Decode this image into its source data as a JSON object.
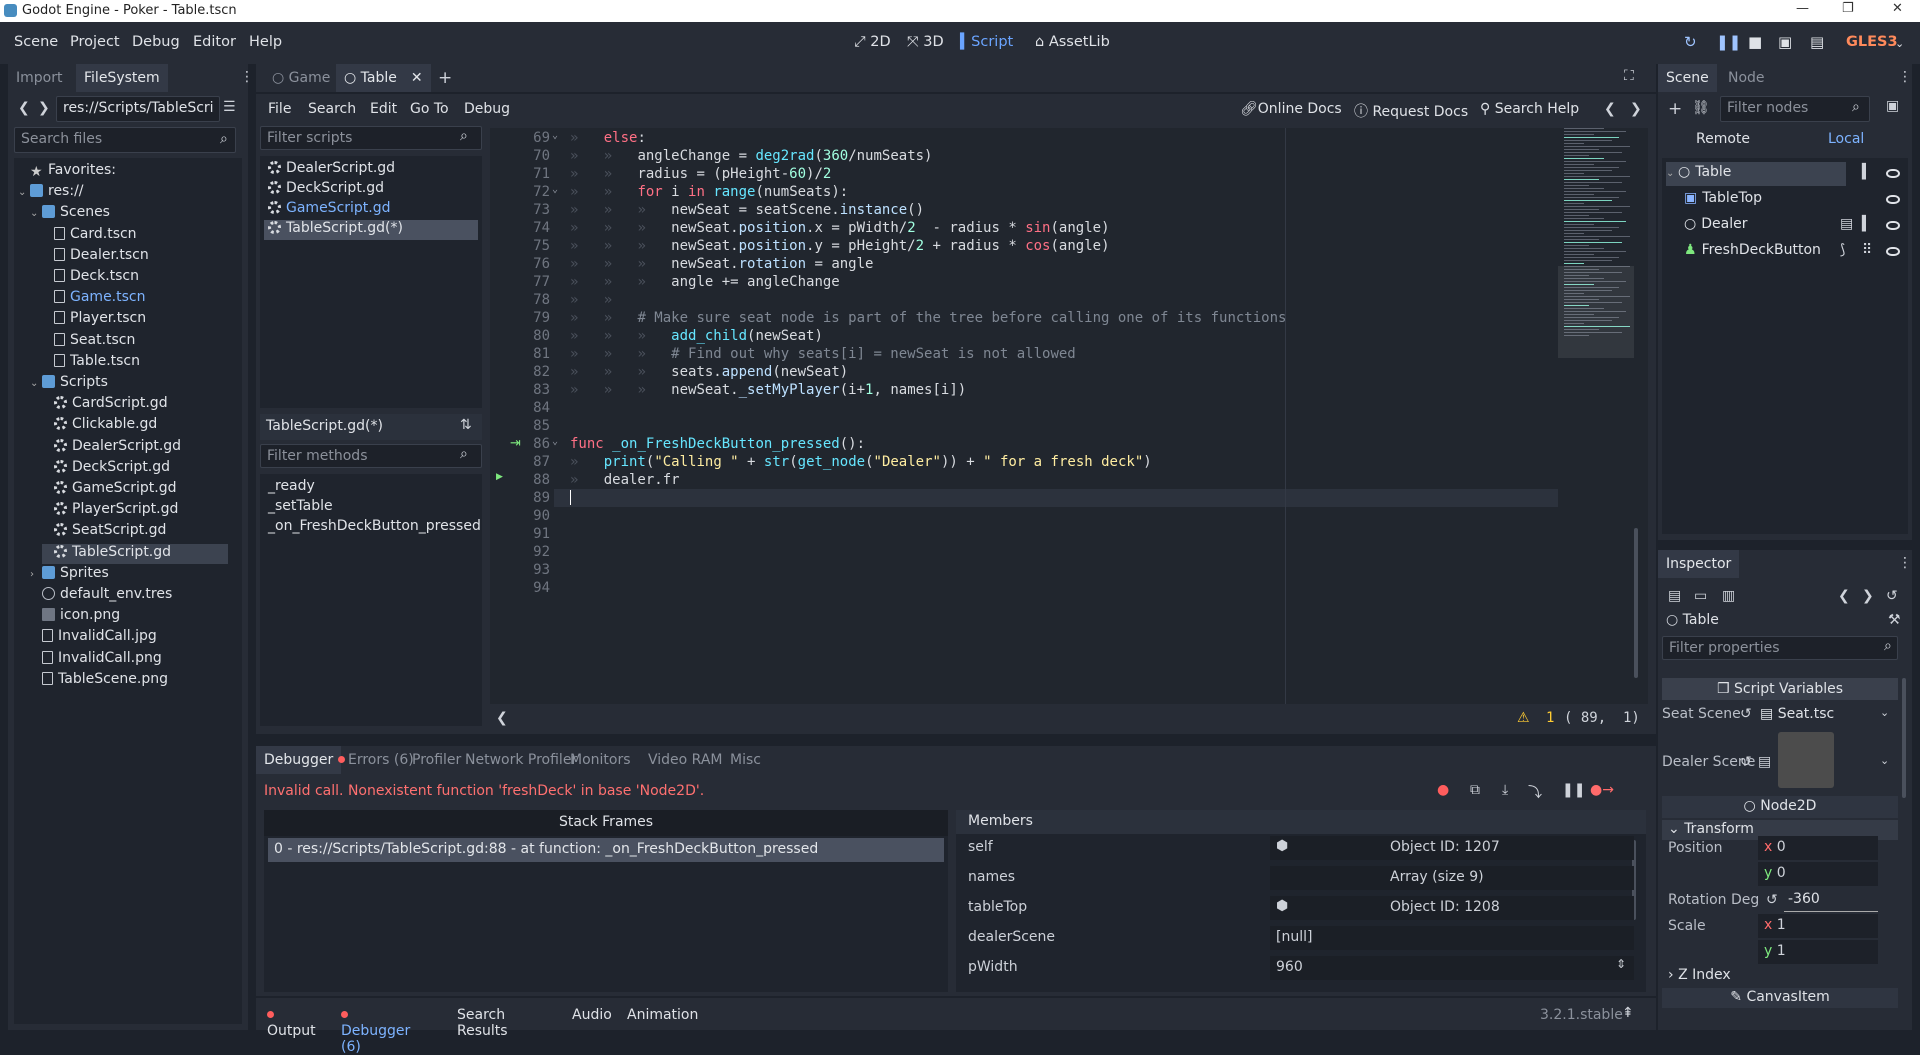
{
  "window": {
    "title": "Godot Engine - Poker - Table.tscn"
  },
  "menu": [
    "Scene",
    "Project",
    "Debug",
    "Editor",
    "Help"
  ],
  "modes": [
    "2D",
    "3D",
    "Script",
    "AssetLib"
  ],
  "renderer": "GLES3",
  "filesystem": {
    "tabs": [
      "Import",
      "FileSystem"
    ],
    "path": "res://Scripts/TableScri",
    "search_placeholder": "Search files",
    "rows": [
      {
        "label": "Favorites:",
        "icon": "star-icon",
        "depth": 0,
        "caret": ""
      },
      {
        "label": "res://",
        "icon": "folder-icon",
        "depth": 0,
        "caret": "v"
      },
      {
        "label": "Scenes",
        "icon": "folder-icon",
        "depth": 1,
        "caret": "v"
      },
      {
        "label": "Card.tscn",
        "icon": "scene-file-icon",
        "depth": 2,
        "caret": ""
      },
      {
        "label": "Dealer.tscn",
        "icon": "scene-file-icon",
        "depth": 2,
        "caret": ""
      },
      {
        "label": "Deck.tscn",
        "icon": "scene-file-icon",
        "depth": 2,
        "caret": ""
      },
      {
        "label": "Game.tscn",
        "icon": "scene-file-icon",
        "depth": 2,
        "caret": "",
        "color": "#7db3ff"
      },
      {
        "label": "Player.tscn",
        "icon": "scene-file-icon",
        "depth": 2,
        "caret": ""
      },
      {
        "label": "Seat.tscn",
        "icon": "scene-file-icon",
        "depth": 2,
        "caret": ""
      },
      {
        "label": "Table.tscn",
        "icon": "scene-file-icon",
        "depth": 2,
        "caret": ""
      },
      {
        "label": "Scripts",
        "icon": "folder-icon",
        "depth": 1,
        "caret": "v"
      },
      {
        "label": "CardScript.gd",
        "icon": "gear-icon",
        "depth": 2,
        "caret": ""
      },
      {
        "label": "Clickable.gd",
        "icon": "gear-icon",
        "depth": 2,
        "caret": ""
      },
      {
        "label": "DealerScript.gd",
        "icon": "gear-icon",
        "depth": 2,
        "caret": ""
      },
      {
        "label": "DeckScript.gd",
        "icon": "gear-icon",
        "depth": 2,
        "caret": ""
      },
      {
        "label": "GameScript.gd",
        "icon": "gear-icon",
        "depth": 2,
        "caret": ""
      },
      {
        "label": "PlayerScript.gd",
        "icon": "gear-icon",
        "depth": 2,
        "caret": ""
      },
      {
        "label": "SeatScript.gd",
        "icon": "gear-icon",
        "depth": 2,
        "caret": ""
      },
      {
        "label": "TableScript.gd",
        "icon": "gear-icon",
        "depth": 2,
        "caret": "",
        "selected": true
      },
      {
        "label": "Sprites",
        "icon": "folder-icon",
        "depth": 1,
        "caret": ">"
      },
      {
        "label": "default_env.tres",
        "icon": "globe-icon",
        "depth": 1,
        "caret": ""
      },
      {
        "label": "icon.png",
        "icon": "image-icon",
        "depth": 1,
        "caret": ""
      },
      {
        "label": "InvalidCall.jpg",
        "icon": "file-icon",
        "depth": 1,
        "caret": ""
      },
      {
        "label": "InvalidCall.png",
        "icon": "file-icon",
        "depth": 1,
        "caret": ""
      },
      {
        "label": "TableScene.png",
        "icon": "file-icon",
        "depth": 1,
        "caret": ""
      }
    ]
  },
  "editor_tabs": [
    {
      "label": "Game"
    },
    {
      "label": "Table",
      "selected": true
    }
  ],
  "script_menu": [
    "File",
    "Search",
    "Edit",
    "Go To",
    "Debug"
  ],
  "help_links": [
    "Online Docs",
    "Request Docs",
    "Search Help"
  ],
  "scripts": {
    "filter_placeholder": "Filter scripts",
    "items": [
      {
        "label": "DealerScript.gd"
      },
      {
        "label": "DeckScript.gd"
      },
      {
        "label": "GameScript.gd",
        "color": "#7db3ff"
      },
      {
        "label": "TableScript.gd(*)",
        "selected": true
      }
    ],
    "current": "TableScript.gd(*)",
    "methods_placeholder": "Filter methods",
    "methods": [
      "_ready",
      "_setTable",
      "_on_FreshDeckButton_pressed"
    ]
  },
  "code": {
    "lines": [
      {
        "n": "69",
        "fold": true,
        "tokens": [
          [
            "i",
            1
          ],
          [
            "kw",
            "else"
          ],
          [
            "t",
            ":"
          ]
        ]
      },
      {
        "n": "70",
        "tokens": [
          [
            "i",
            2
          ],
          [
            "t",
            "angleChange = "
          ],
          [
            "fn",
            "deg2rad"
          ],
          [
            "t",
            "("
          ],
          [
            "nb",
            "360"
          ],
          [
            "t",
            "/numSeats)"
          ]
        ]
      },
      {
        "n": "71",
        "tokens": [
          [
            "i",
            2
          ],
          [
            "t",
            "radius = (pHeight-"
          ],
          [
            "nb",
            "60"
          ],
          [
            "t",
            ")/"
          ],
          [
            "nb",
            "2"
          ]
        ]
      },
      {
        "n": "72",
        "fold": true,
        "tokens": [
          [
            "i",
            2
          ],
          [
            "kw",
            "for"
          ],
          [
            "t",
            " i "
          ],
          [
            "kw",
            "in"
          ],
          [
            "t",
            " "
          ],
          [
            "fn",
            "range"
          ],
          [
            "t",
            "(numSeats):"
          ]
        ]
      },
      {
        "n": "73",
        "tokens": [
          [
            "i",
            3
          ],
          [
            "t",
            "newSeat = seatScene."
          ],
          [
            "mm",
            "instance"
          ],
          [
            "t",
            "()"
          ]
        ]
      },
      {
        "n": "74",
        "tokens": [
          [
            "i",
            3
          ],
          [
            "t",
            "newSeat."
          ],
          [
            "mm",
            "position"
          ],
          [
            "t",
            ".x = pWidth/"
          ],
          [
            "nb",
            "2"
          ],
          [
            "t",
            "  - radius * "
          ],
          [
            "kw",
            "sin"
          ],
          [
            "t",
            "(angle)"
          ]
        ]
      },
      {
        "n": "75",
        "tokens": [
          [
            "i",
            3
          ],
          [
            "t",
            "newSeat."
          ],
          [
            "mm",
            "position"
          ],
          [
            "t",
            ".y = pHeight/"
          ],
          [
            "nb",
            "2"
          ],
          [
            "t",
            " + radius * "
          ],
          [
            "kw",
            "cos"
          ],
          [
            "t",
            "(angle)"
          ]
        ]
      },
      {
        "n": "76",
        "tokens": [
          [
            "i",
            3
          ],
          [
            "t",
            "newSeat."
          ],
          [
            "mm",
            "rotation"
          ],
          [
            "t",
            " = angle"
          ]
        ]
      },
      {
        "n": "77",
        "tokens": [
          [
            "i",
            3
          ],
          [
            "t",
            "angle += angleChange"
          ]
        ]
      },
      {
        "n": "78",
        "tokens": [
          [
            "i",
            2
          ]
        ]
      },
      {
        "n": "79",
        "tokens": [
          [
            "i",
            2
          ],
          [
            "cm",
            "# Make sure seat node is part of the tree before calling one of its functions"
          ]
        ]
      },
      {
        "n": "80",
        "tokens": [
          [
            "i",
            3
          ],
          [
            "fn",
            "add_child"
          ],
          [
            "t",
            "(newSeat)"
          ]
        ]
      },
      {
        "n": "81",
        "tokens": [
          [
            "i",
            3
          ],
          [
            "cm",
            "# Find out why seats[i] = newSeat is not allowed"
          ]
        ]
      },
      {
        "n": "82",
        "tokens": [
          [
            "i",
            3
          ],
          [
            "t",
            "seats."
          ],
          [
            "mm",
            "append"
          ],
          [
            "t",
            "(newSeat)"
          ]
        ]
      },
      {
        "n": "83",
        "tokens": [
          [
            "i",
            3
          ],
          [
            "t",
            "newSeat."
          ],
          [
            "mm",
            "_setMyPlayer"
          ],
          [
            "t",
            "(i+"
          ],
          [
            "nb",
            "1"
          ],
          [
            "t",
            ", names[i])"
          ]
        ]
      },
      {
        "n": "84",
        "tokens": []
      },
      {
        "n": "85",
        "tokens": []
      },
      {
        "n": "86",
        "fold": true,
        "signal": true,
        "tokens": [
          [
            "kw",
            "func"
          ],
          [
            "t",
            " "
          ],
          [
            "fn",
            "_on_FreshDeckButton_pressed"
          ],
          [
            "t",
            "():"
          ]
        ]
      },
      {
        "n": "87",
        "tokens": [
          [
            "i",
            1
          ],
          [
            "fn",
            "print"
          ],
          [
            "t",
            "("
          ],
          [
            "st",
            "\"Calling \""
          ],
          [
            "t",
            " + "
          ],
          [
            "fn",
            "str"
          ],
          [
            "t",
            "("
          ],
          [
            "fn",
            "get_node"
          ],
          [
            "t",
            "("
          ],
          [
            "st",
            "\"Dealer\""
          ],
          [
            "t",
            ")) + "
          ],
          [
            "st",
            "\" for a fresh deck\""
          ],
          [
            "t",
            ")"
          ]
        ]
      },
      {
        "n": "88",
        "exec": true,
        "tokens": [
          [
            "i",
            1
          ],
          [
            "t",
            "dealer.fr"
          ]
        ]
      },
      {
        "n": "89",
        "current": true,
        "tokens": []
      },
      {
        "n": "90",
        "tokens": []
      },
      {
        "n": "91",
        "tokens": []
      },
      {
        "n": "92",
        "tokens": []
      },
      {
        "n": "93",
        "tokens": []
      },
      {
        "n": "94",
        "tokens": []
      }
    ],
    "warning_count": "1",
    "cursor": "( 89,  1)"
  },
  "debugger": {
    "tabs": [
      {
        "label": "Debugger",
        "selected": true
      },
      {
        "label": "Errors (6)",
        "dot": true
      },
      {
        "label": "Profiler"
      },
      {
        "label": "Network Profiler"
      },
      {
        "label": "Monitors"
      },
      {
        "label": "Video RAM"
      },
      {
        "label": "Misc"
      }
    ],
    "error": "Invalid call. Nonexistent function 'freshDeck' in base 'Node2D'.",
    "stack_header": "Stack Frames",
    "frame": "0 - res://Scripts/TableScript.gd:88 - at function: _on_FreshDeckButton_pressed",
    "members_header": "Members",
    "members": [
      {
        "name": "self",
        "value": "Object ID: 1207",
        "obj": true
      },
      {
        "name": "names",
        "value": "Array (size 9)"
      },
      {
        "name": "tableTop",
        "value": "Object ID: 1208",
        "obj": true
      },
      {
        "name": "dealerScene",
        "value": "[null]"
      },
      {
        "name": "pWidth",
        "value": "960"
      }
    ]
  },
  "bottom_tabs": [
    {
      "label": "Output",
      "dot": true
    },
    {
      "label": "Debugger (6)",
      "dot": true,
      "color": "#7db3ff"
    },
    {
      "label": "Search Results"
    },
    {
      "label": "Audio"
    },
    {
      "label": "Animation"
    }
  ],
  "version": "3.2.1.stable",
  "scene": {
    "tabs": [
      "Scene",
      "Node"
    ],
    "filter_placeholder": "Filter nodes",
    "remote": "Remote",
    "local": "Local",
    "nodes": [
      {
        "label": "Table",
        "depth": 0,
        "selected": true
      },
      {
        "label": "TableTop",
        "depth": 1
      },
      {
        "label": "Dealer",
        "depth": 1
      },
      {
        "label": "FreshDeckButton",
        "depth": 1
      }
    ]
  },
  "inspector": {
    "title": "Inspector",
    "object": "Table",
    "filter_placeholder": "Filter properties",
    "section": "Script Variables",
    "seat_scene_label": "Seat Scene",
    "seat_scene_value": "Seat.tsc",
    "dealer_scene_label": "Dealer Scene",
    "class": "Node2D",
    "transform": "Transform",
    "position_label": "Position",
    "pos_x": "0",
    "pos_y": "0",
    "rotation_label": "Rotation Deg",
    "rotation_value": "-360",
    "scale_label": "Scale",
    "scale_x": "1",
    "scale_y": "1",
    "zindex": "Z Index",
    "canvas": "CanvasItem"
  }
}
